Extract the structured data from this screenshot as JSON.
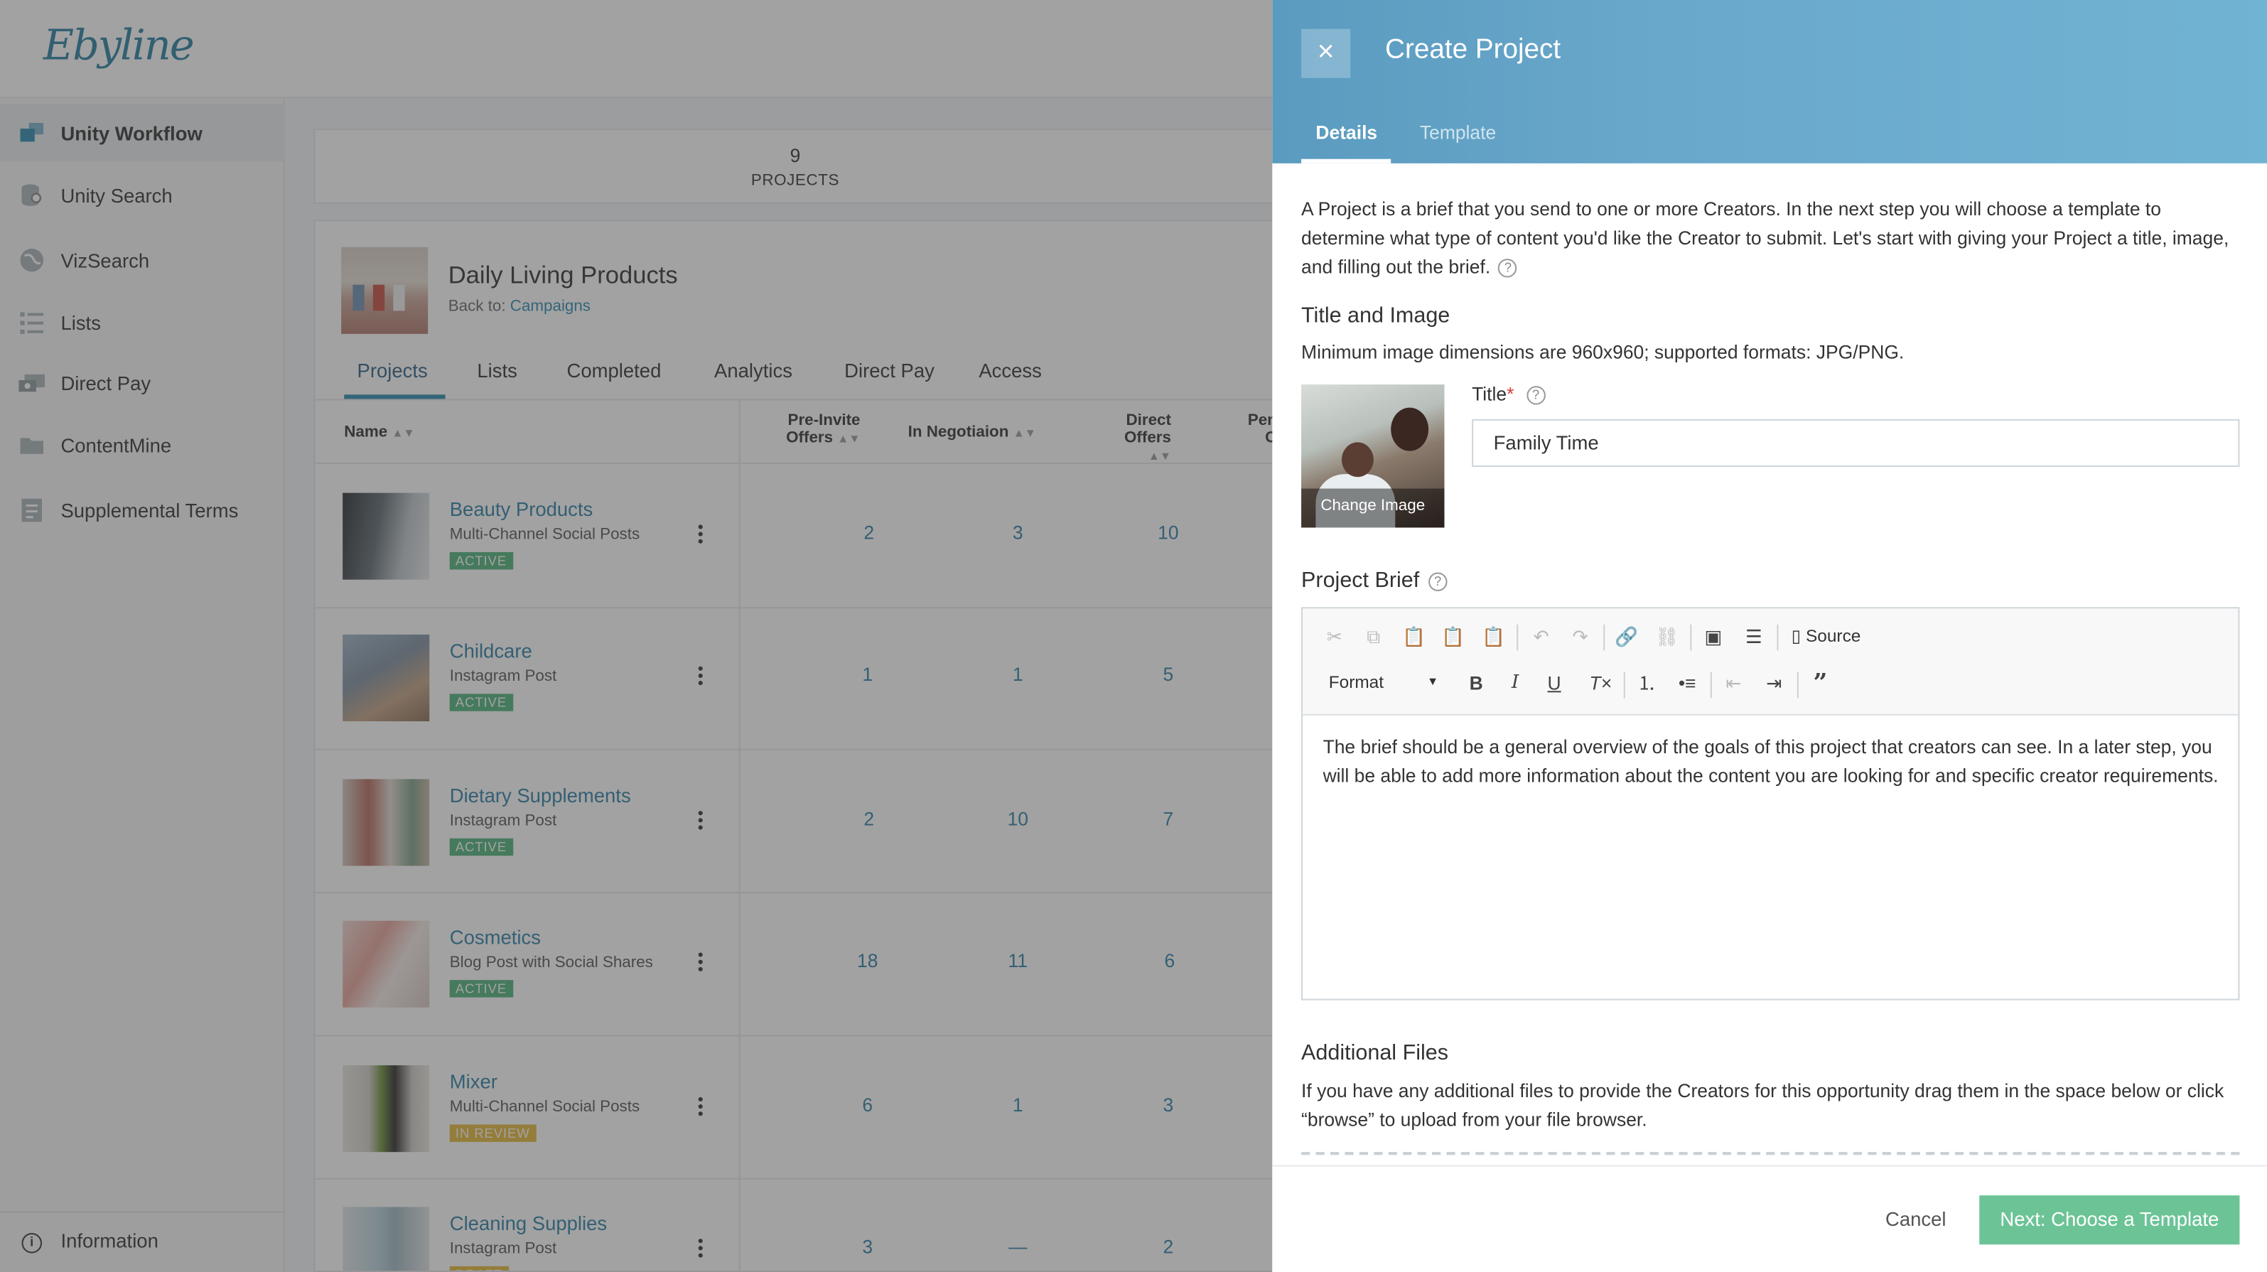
{
  "brand": {
    "logo_text": "Ebyline"
  },
  "sidebar": {
    "items": [
      {
        "label": "Unity Workflow",
        "icon": "workflow-icon",
        "active": true
      },
      {
        "label": "Unity Search",
        "icon": "search-db-icon"
      },
      {
        "label": "VizSearch",
        "icon": "globe-icon"
      },
      {
        "label": "Lists",
        "icon": "list-icon"
      },
      {
        "label": "Direct Pay",
        "icon": "money-icon"
      },
      {
        "label": "ContentMine",
        "icon": "folder-icon"
      },
      {
        "label": "Supplemental Terms",
        "icon": "document-icon"
      }
    ],
    "info_label": "Information"
  },
  "stats": {
    "projects_count": "9",
    "projects_label": "PROJECTS"
  },
  "campaign": {
    "title": "Daily Living Products",
    "back_prefix": "Back to:",
    "back_link": "Campaigns",
    "tabs": [
      "Projects",
      "Lists",
      "Completed",
      "Analytics",
      "Direct Pay",
      "Access"
    ],
    "columns": {
      "name": "Name",
      "pre_invite_1": "Pre-Invite",
      "pre_invite_2": "Offers",
      "negotiation": "In Negotiaion",
      "direct_1": "Direct",
      "direct_2": "Offers",
      "pending_1": "Pen",
      "pending_2": "O"
    },
    "rows": [
      {
        "name": "Beauty Products",
        "type": "Multi-Channel Social Posts",
        "status": "ACTIVE",
        "pre_invite": "2",
        "negotiation": "3",
        "direct": "10"
      },
      {
        "name": "Childcare",
        "type": "Instagram Post",
        "status": "ACTIVE",
        "pre_invite": "1",
        "negotiation": "1",
        "direct": "5"
      },
      {
        "name": "Dietary Supplements",
        "type": "Instagram Post",
        "status": "ACTIVE",
        "pre_invite": "2",
        "negotiation": "10",
        "direct": "7"
      },
      {
        "name": "Cosmetics",
        "type": "Blog Post with Social Shares",
        "status": "ACTIVE",
        "pre_invite": "18",
        "negotiation": "11",
        "direct": "6"
      },
      {
        "name": "Mixer",
        "type": "Multi-Channel Social Posts",
        "status": "IN REVIEW",
        "pre_invite": "6",
        "negotiation": "1",
        "direct": "3"
      },
      {
        "name": "Cleaning Supplies",
        "type": "Instagram Post",
        "status": "DRAFT",
        "pre_invite": "3",
        "negotiation": "—",
        "direct": "2"
      }
    ]
  },
  "drawer": {
    "close_symbol": "×",
    "title": "Create Project",
    "tabs": {
      "details": "Details",
      "template": "Template"
    },
    "intro": "A Project is a brief that you send to one or more Creators. In the next step you will choose a template to determine what type of content you'd like the Creator to submit. Let's start with giving your Project a title, image, and filling out the brief.",
    "help_symbol": "?",
    "title_image_heading": "Title and Image",
    "image_requirements": "Minimum image dimensions are 960x960; supported formats: JPG/PNG.",
    "change_image": "Change Image",
    "title_label": "Title",
    "required_mark": "*",
    "title_value": "Family Time",
    "brief_heading": "Project Brief",
    "toolbar": {
      "source_label": "Source",
      "format_label": "Format"
    },
    "brief_text": "The brief should be a general overview of the goals of this project that creators can see.  In a later step, you will be able to add more information about the content you are looking for and specific creator requirements.",
    "additional_heading": "Additional Files",
    "additional_text": "If you have any additional files to provide the Creators for this opportunity drag them in the space below or click “browse” to upload from your file browser.",
    "cancel_label": "Cancel",
    "next_label": "Next: Choose a Template"
  },
  "colors": {
    "accent": "#2c8ab0",
    "drawer_header": "#6aa8cb",
    "primary_button": "#6cc496",
    "badge_active": "#4fb27b",
    "badge_review": "#e5b83a"
  }
}
